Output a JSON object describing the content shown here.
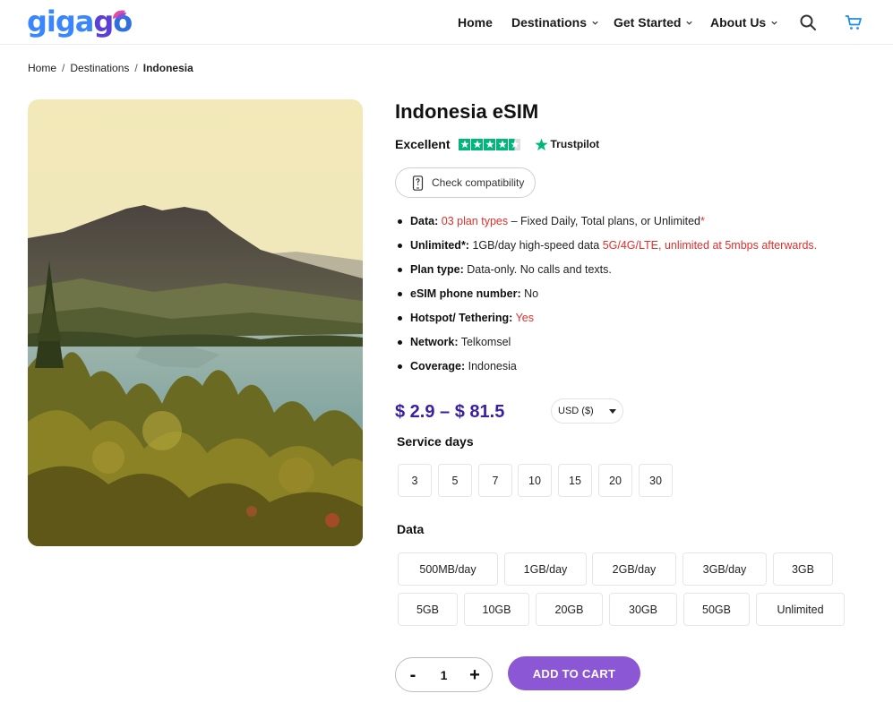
{
  "logo": {
    "text_1": "giga",
    "text_2": "g",
    "text_3": "o"
  },
  "nav": {
    "home": "Home",
    "destinations": "Destinations",
    "get_started": "Get Started",
    "about_us": "About Us"
  },
  "breadcrumb": {
    "home": "Home",
    "destinations": "Destinations",
    "current": "Indonesia",
    "separator": "/"
  },
  "product": {
    "title": "Indonesia eSIM",
    "rating_label": "Excellent",
    "stars_shown": 4.5,
    "trustpilot": "Trustpilot",
    "check_compat": "Check compatibility",
    "features": [
      {
        "label": "Data:",
        "parts": [
          {
            "t": " ",
            "red": false
          },
          {
            "t": "03 plan types",
            "red": true
          },
          {
            "t": " – Fixed Daily, Total plans, or Unlimited",
            "red": false
          },
          {
            "t": "*",
            "red": true
          }
        ]
      },
      {
        "label": "Unlimited*:",
        "parts": [
          {
            "t": " 1GB/day high-speed data ",
            "red": false
          },
          {
            "t": "5G/4G/LTE, unlimited at 5mbps afterwards.",
            "red": true
          }
        ]
      },
      {
        "label": "Plan type:",
        "parts": [
          {
            "t": " Data-only. No calls and texts.",
            "red": false
          }
        ]
      },
      {
        "label": "eSIM phone number:",
        "parts": [
          {
            "t": " No",
            "red": false
          }
        ]
      },
      {
        "label": "Hotspot/ Tethering:",
        "parts": [
          {
            "t": " ",
            "red": false
          },
          {
            "t": "Yes",
            "red": true
          }
        ]
      },
      {
        "label": "Network:",
        "parts": [
          {
            "t": " Telkomsel",
            "red": false
          }
        ]
      },
      {
        "label": "Coverage:",
        "parts": [
          {
            "t": " Indonesia",
            "red": false
          }
        ]
      }
    ],
    "price": "$ 2.9 – $ 81.5",
    "currency": "USD ($)",
    "service_days_label": "Service days",
    "service_days": [
      "3",
      "5",
      "7",
      "10",
      "15",
      "20",
      "30"
    ],
    "data_label": "Data",
    "data_row_1": [
      "500MB/day",
      "1GB/day",
      "2GB/day",
      "3GB/day",
      "3GB"
    ],
    "data_row_2": [
      "5GB",
      "10GB",
      "20GB",
      "30GB",
      "50GB",
      "Unlimited"
    ],
    "qty_minus": "-",
    "qty_value": "1",
    "qty_plus": "+",
    "add_to_cart": "ADD TO CART"
  },
  "colors": {
    "accent": "#3b1fa3",
    "button": "#8b57d4",
    "red": "#e0302b",
    "trustpilot": "#00b67a"
  }
}
